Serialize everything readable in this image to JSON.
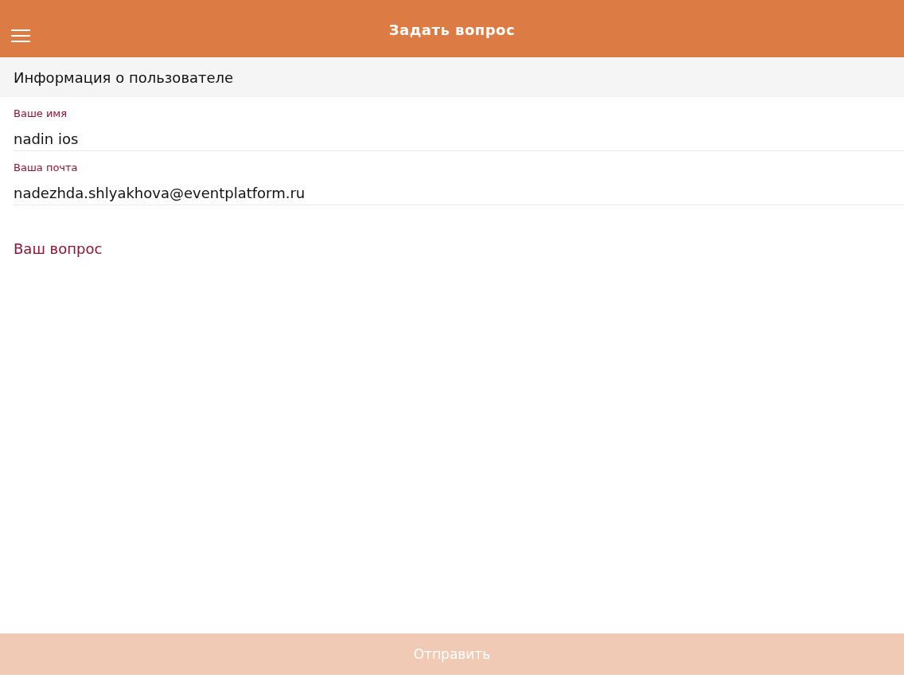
{
  "header": {
    "title": "Задать вопрос"
  },
  "section": {
    "title": "Информация о пользователе"
  },
  "fields": [
    {
      "label": "Ваше имя",
      "value": "nadin ios"
    },
    {
      "label": "Ваша почта",
      "value": "nadezhda.shlyakhova@eventplatform.ru"
    }
  ],
  "question": {
    "label": "Ваш вопрос"
  },
  "submit": {
    "label": "Отправить",
    "disabled": true
  }
}
